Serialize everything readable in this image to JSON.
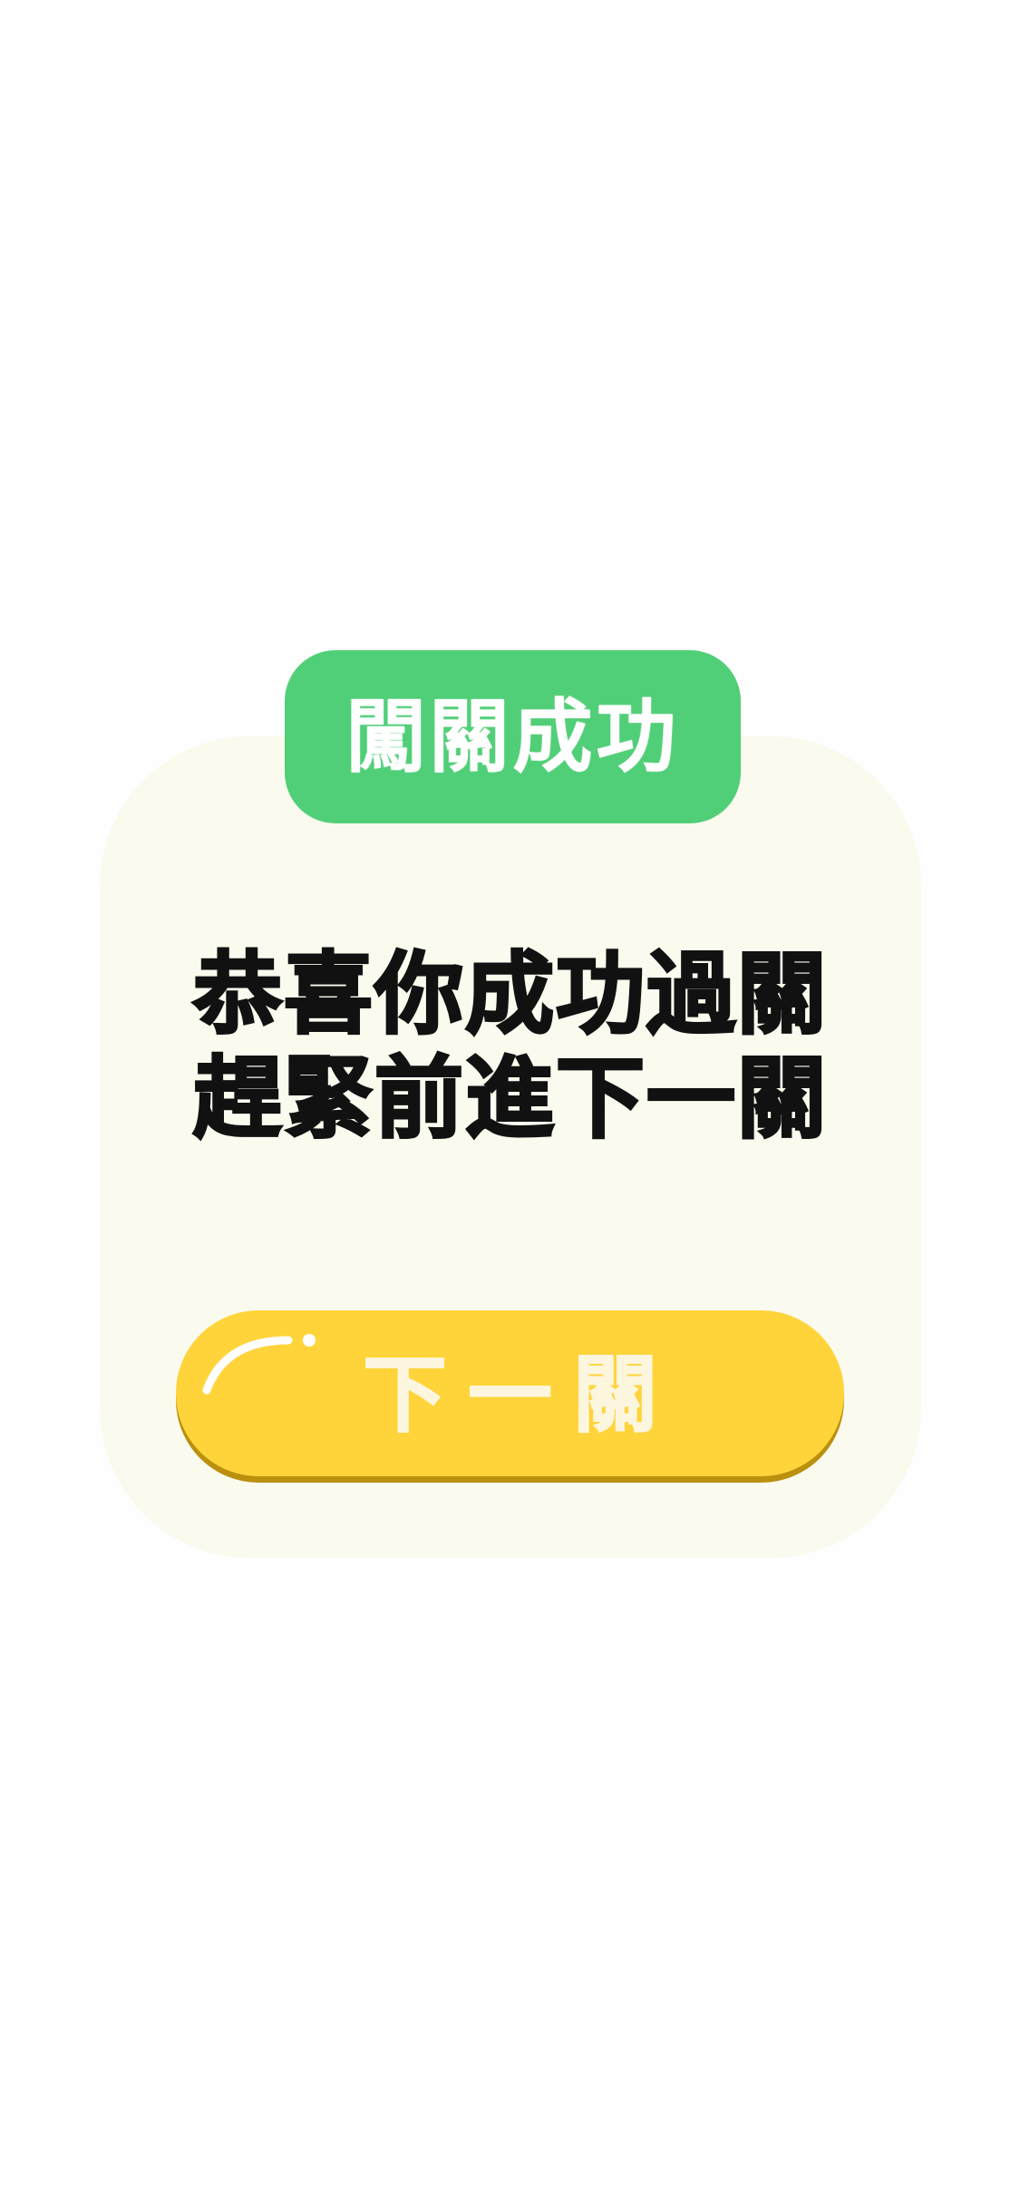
{
  "dialog": {
    "title": "闖關成功",
    "message_lines": [
      "恭喜你成功過關",
      "趕緊前進下一關"
    ],
    "next_button_label": "下一關"
  },
  "colors": {
    "page_background": "#FEFEFE",
    "card_background": "#FAFBEE",
    "title_badge": "#51CF78",
    "button_fill": "#FFD43B",
    "button_shadow": "#BA900D",
    "message_text": "#111111",
    "button_text": "#FDF6DF"
  },
  "icons": {
    "button_gloss": "gloss-highlight-icon"
  }
}
